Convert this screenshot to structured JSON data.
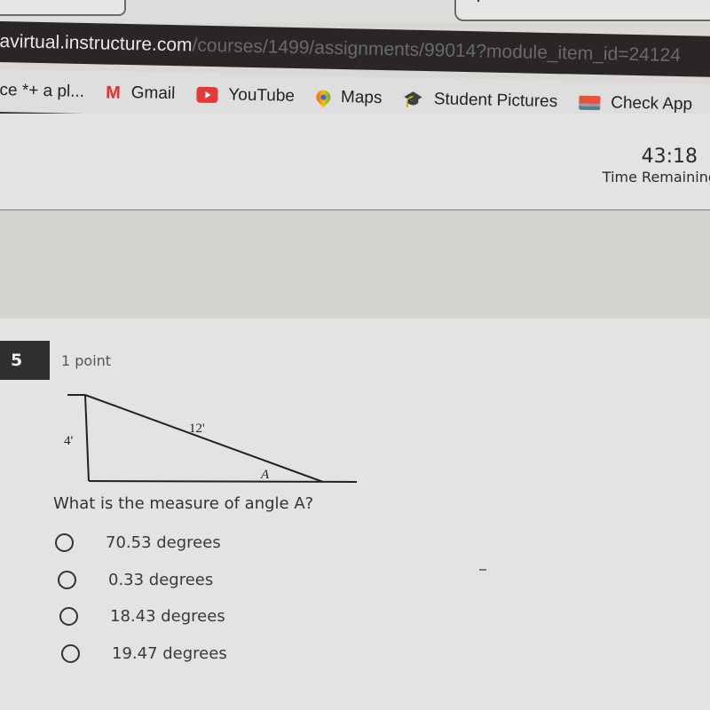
{
  "browser": {
    "url_host": "avirtual.instructure.com",
    "url_path": "/courses/1499/assignments/99014?module_item_id=24124",
    "bookmarks": [
      {
        "label": "ce *+ a pl...",
        "icon": "none"
      },
      {
        "label": "Gmail",
        "icon": "gmail-icon"
      },
      {
        "label": "YouTube",
        "icon": "youtube-icon"
      },
      {
        "label": "Maps",
        "icon": "maps-icon"
      },
      {
        "label": "Student Pictures",
        "icon": "graduation-cap-icon"
      },
      {
        "label": "Check App",
        "icon": "check-app-icon"
      }
    ]
  },
  "quiz": {
    "timer_value": "43:18",
    "timer_label": "Time Remaining"
  },
  "question": {
    "number": "5",
    "points": "1 point",
    "diagram": {
      "side_label": "4'",
      "hypotenuse_label": "12'",
      "angle_label": "A"
    },
    "text": "What is the measure of angle A?",
    "options": [
      {
        "label": "70.53 degrees",
        "selected": false
      },
      {
        "label": "0.33 degrees",
        "selected": false
      },
      {
        "label": "18.43 degrees",
        "selected": false
      },
      {
        "label": "19.47 degrees",
        "selected": false
      }
    ]
  }
}
